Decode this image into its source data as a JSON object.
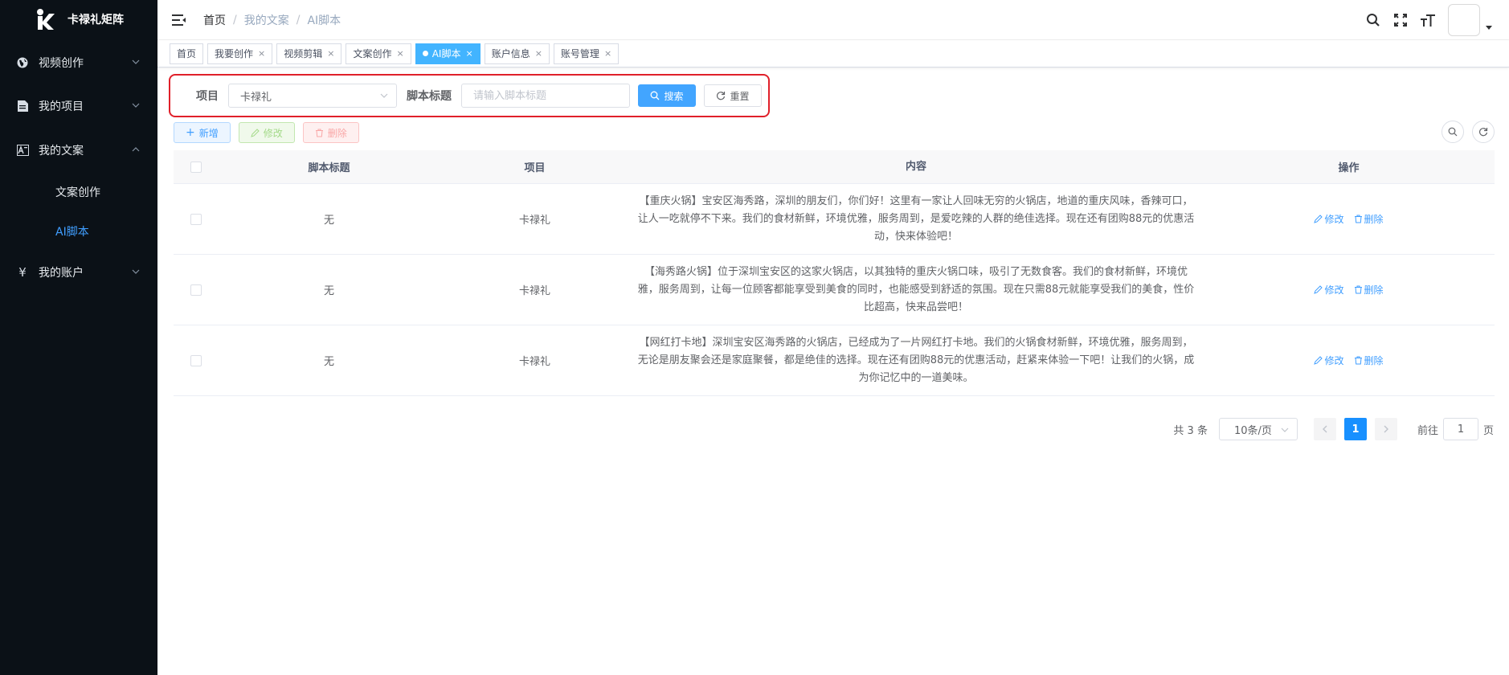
{
  "app": {
    "logo_text": "卡禄礼矩阵"
  },
  "sidebar": {
    "items": [
      {
        "label": "视频创作",
        "icon": "globe-icon"
      },
      {
        "label": "我的项目",
        "icon": "document-icon"
      },
      {
        "label": "我的文案",
        "icon": "text-image-icon"
      },
      {
        "label": "我的账户",
        "icon": "yen-icon"
      }
    ],
    "submenu": [
      {
        "label": "文案创作"
      },
      {
        "label": "AI脚本"
      }
    ]
  },
  "breadcrumb": [
    "首页",
    "我的文案",
    "AI脚本"
  ],
  "tags": [
    {
      "label": "首页"
    },
    {
      "label": "我要创作"
    },
    {
      "label": "视频剪辑"
    },
    {
      "label": "文案创作"
    },
    {
      "label": "AI脚本"
    },
    {
      "label": "账户信息"
    },
    {
      "label": "账号管理"
    }
  ],
  "search": {
    "project_label": "项目",
    "project_value": "卡禄礼",
    "title_label": "脚本标题",
    "title_placeholder": "请输入脚本标题",
    "search_button": "搜索",
    "reset_button": "重置"
  },
  "toolbar": {
    "add": "新增",
    "edit": "修改",
    "delete": "删除"
  },
  "table": {
    "headers": {
      "title": "脚本标题",
      "project": "项目",
      "content": "内容",
      "ops": "操作"
    },
    "rows": [
      {
        "title": "无",
        "project": "卡禄礼",
        "content": "【重庆火锅】宝安区海秀路，深圳的朋友们，你们好！这里有一家让人回味无穷的火锅店，地道的重庆风味，香辣可口，让人一吃就停不下来。我们的食材新鲜，环境优雅，服务周到，是爱吃辣的人群的绝佳选择。现在还有团购88元的优惠活动，快来体验吧！",
        "edit": "修改",
        "delete": "删除"
      },
      {
        "title": "无",
        "project": "卡禄礼",
        "content": "【海秀路火锅】位于深圳宝安区的这家火锅店，以其独特的重庆火锅口味，吸引了无数食客。我们的食材新鲜，环境优雅，服务周到，让每一位顾客都能享受到美食的同时，也能感受到舒适的氛围。现在只需88元就能享受我们的美食，性价比超高，快来品尝吧！",
        "edit": "修改",
        "delete": "删除"
      },
      {
        "title": "无",
        "project": "卡禄礼",
        "content": "【网红打卡地】深圳宝安区海秀路的火锅店，已经成为了一片网红打卡地。我们的火锅食材新鲜，环境优雅，服务周到，无论是朋友聚会还是家庭聚餐，都是绝佳的选择。现在还有团购88元的优惠活动，赶紧来体验一下吧！让我们的火锅，成为你记忆中的一道美味。",
        "edit": "修改",
        "delete": "删除"
      }
    ]
  },
  "pagination": {
    "total": "共 3 条",
    "page_size": "10条/页",
    "current": "1",
    "goto_prefix": "前往",
    "goto_value": "1",
    "goto_suffix": "页"
  },
  "colors": {
    "accent": "#409eff",
    "sidebar_bg": "#0b1117",
    "highlight_border": "#e0202a"
  }
}
